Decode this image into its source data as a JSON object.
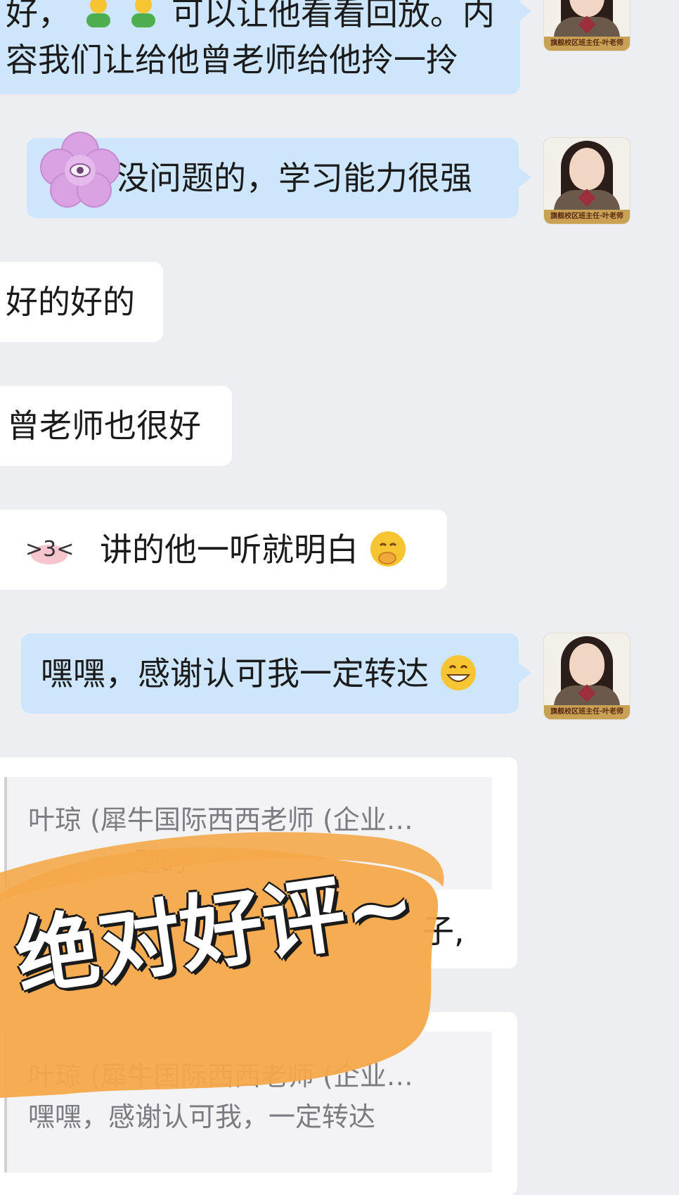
{
  "messages": {
    "m1_line1": "好，",
    "m1_line1b": "可以让他看看回放。内",
    "m1_line2": "容我们让给他曾老师给他拎一拎",
    "m2": "没问题的，学习能力很强",
    "m3": "好的好的",
    "m4": "曾老师也很好",
    "m5": "讲的他一听就明白",
    "m6": "嘿嘿，感谢认可我一定转达",
    "q1_sender": "叶琼 (犀牛国际西西老师 (企业…",
    "q1_body_partial": "题的",
    "q1_reply_partial": "子,",
    "q2_sender": "叶琼 (犀牛国际西西老师 (企业…",
    "q2_body_partial": "嘿嘿，感谢认可我，一定转达"
  },
  "avatar": {
    "banner": "旗舰校区班主任·叶老师"
  },
  "overlay": {
    "headline": "绝对好评~",
    "doodle": ">3<"
  },
  "colors": {
    "bg": "#edeef2",
    "mine_bubble": "#cde6fb",
    "theirs_bubble": "#ffffff",
    "brush": "#f5a84a"
  }
}
